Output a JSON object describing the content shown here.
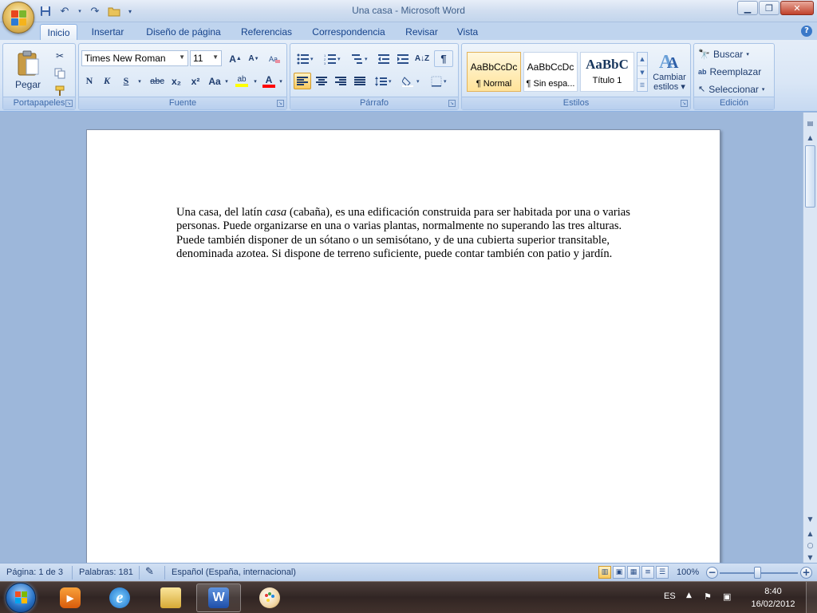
{
  "window": {
    "title": "Una casa - Microsoft Word",
    "controls": {
      "minimize": "▁",
      "maximize": "❐",
      "close": "✕"
    }
  },
  "quick_access": {
    "icons": [
      "save-icon",
      "undo-icon",
      "redo-icon",
      "open-icon",
      "customize-icon"
    ]
  },
  "tabs": [
    "Inicio",
    "Insertar",
    "Diseño de página",
    "Referencias",
    "Correspondencia",
    "Revisar",
    "Vista"
  ],
  "active_tab": "Inicio",
  "ribbon": {
    "portapapeles": {
      "label": "Portapapeles",
      "paste_label": "Pegar"
    },
    "fuente": {
      "label": "Fuente",
      "font_name": "Times New Roman",
      "font_size": "11",
      "bold": "N",
      "italic": "K",
      "underline": "S",
      "strikethrough": "abc",
      "subscript": "x₂",
      "superscript": "x²",
      "change_case": "Aa",
      "grow": "A",
      "shrink": "A",
      "highlight": "ab",
      "font_color": "A"
    },
    "parrafo": {
      "label": "Párrafo",
      "pilcrow": "¶"
    },
    "estilos": {
      "label": "Estilos",
      "styles": [
        {
          "sample": "AaBbCcDc",
          "name": "¶ Normal"
        },
        {
          "sample": "AaBbCcDc",
          "name": "¶ Sin espa..."
        },
        {
          "sample": "AaBbC",
          "name": "Título 1"
        }
      ],
      "change_styles": [
        "Cambiar",
        "estilos"
      ]
    },
    "edicion": {
      "label": "Edición",
      "find": "Buscar",
      "replace": "Reemplazar",
      "select": "Seleccionar"
    }
  },
  "document": {
    "p_before_italic": "Una casa, del latín ",
    "p_italic": "casa",
    "p_after_italic": " (cabaña), es una edificación construida para ser habitada por una o varias personas. Puede organizarse en una o varias plantas, normalmente no superando las tres alturas. Puede también disponer de un sótano o un semisótano, y de una cubierta superior transitable, denominada azotea. Si dispone de terreno suficiente, puede contar también con patio y jardín."
  },
  "status_bar": {
    "page": "Página: 1 de 3",
    "words": "Palabras: 181",
    "language": "Español (España, internacional)",
    "zoom": "100%",
    "zoom_level_percent": 100
  },
  "taskbar": {
    "apps": [
      "windows-media-player",
      "internet-explorer",
      "windows-explorer",
      "microsoft-word",
      "paint"
    ],
    "language": "ES",
    "time": "8:40",
    "date": "16/02/2012"
  },
  "colors": {
    "ribbon_text": "#15428b",
    "page_background": "#ffffff",
    "workspace": "#9db7da"
  }
}
